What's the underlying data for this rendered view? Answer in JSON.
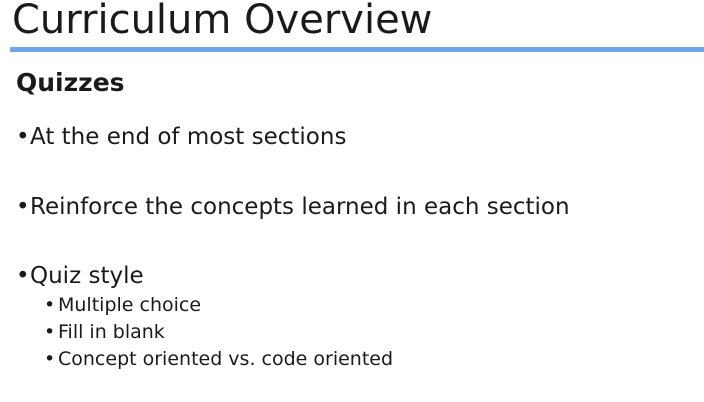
{
  "slide": {
    "title": "Curriculum Overview",
    "subtitle": "Quizzes",
    "bullets": [
      {
        "text": "At the end of most sections"
      },
      {
        "text": "Reinforce the concepts learned in each section"
      },
      {
        "text": "Quiz style",
        "sub_bullets": [
          "Multiple choice",
          "Fill in blank",
          "Concept oriented vs. code oriented"
        ]
      }
    ],
    "colors": {
      "title_rule": "#6fa8e8",
      "text": "#1a1a1a",
      "background": "#ffffff"
    },
    "bullet_glyph": "•"
  }
}
